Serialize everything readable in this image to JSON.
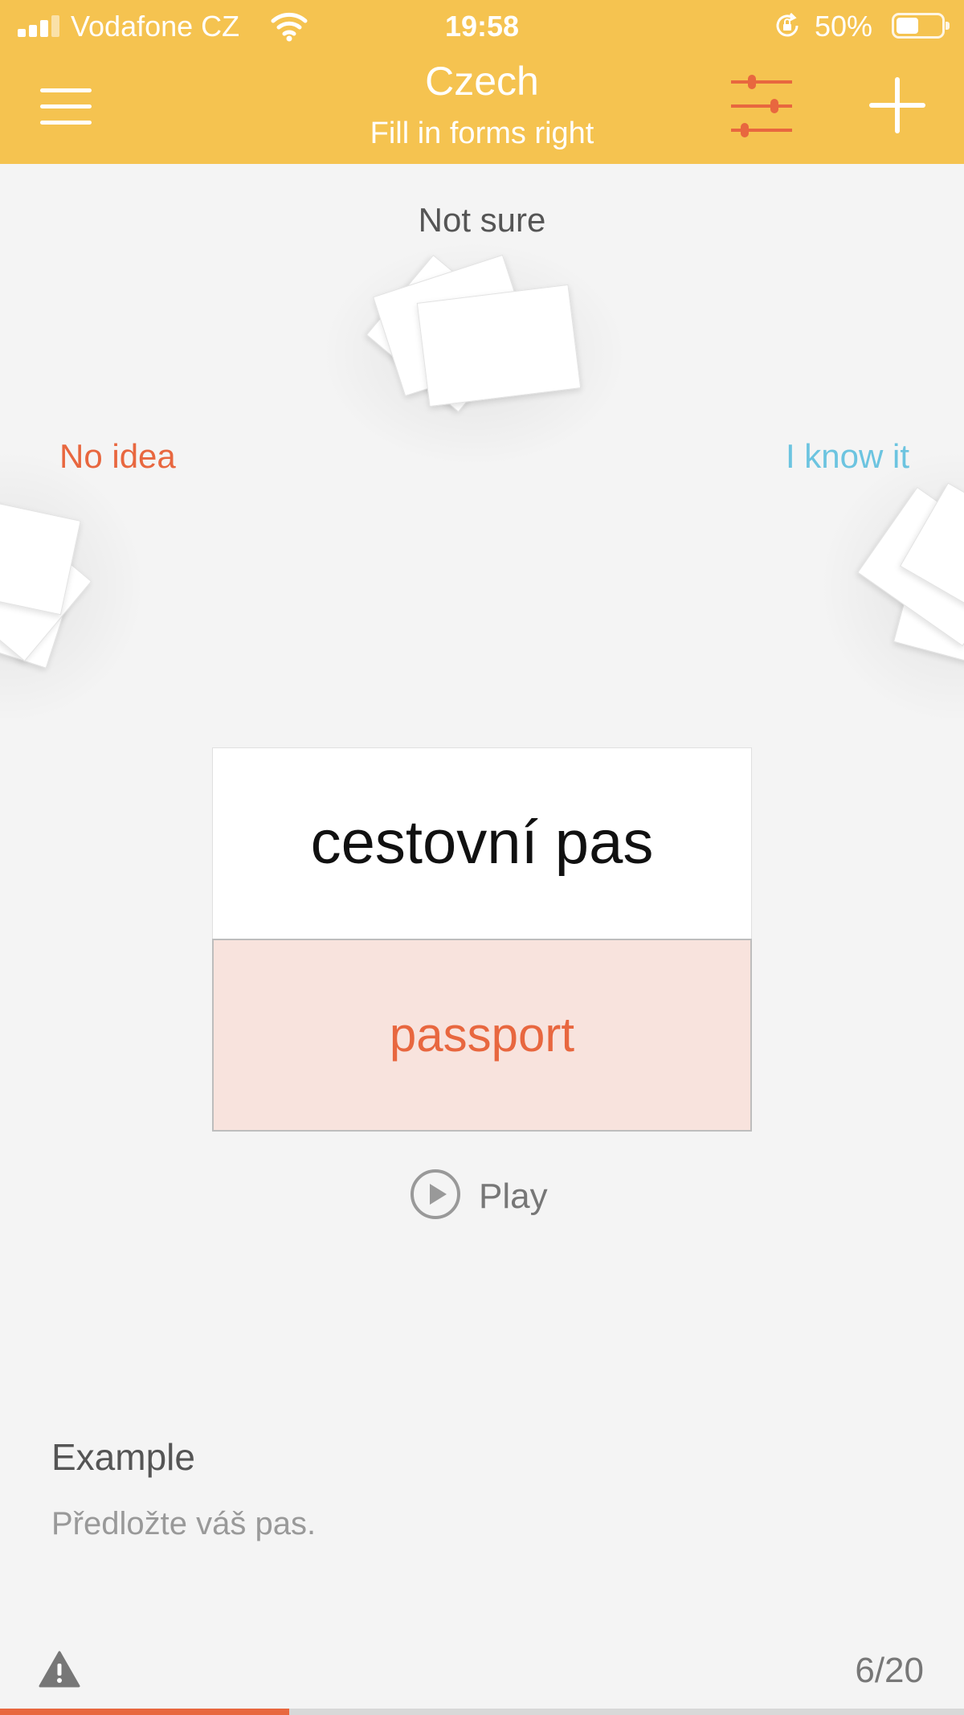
{
  "status_bar": {
    "carrier": "Vodafone CZ",
    "time": "19:58",
    "battery": "50%"
  },
  "header": {
    "title": "Czech",
    "subtitle": "Fill in forms right",
    "menu_icon": "hamburger-menu-icon",
    "filter_icon": "sliders-icon",
    "add_icon": "plus-icon"
  },
  "piles": {
    "not_sure": "Not sure",
    "no_idea": "No idea",
    "know_it": "I know it"
  },
  "card": {
    "front": "cestovní pas",
    "back": "passport"
  },
  "audio": {
    "play_label": "Play",
    "icon": "play-circle-icon"
  },
  "example": {
    "title": "Example",
    "sentence": "Předložte váš pas."
  },
  "footer": {
    "warning_icon": "warning-icon",
    "counter": "6/20",
    "progress_fraction": 0.3
  },
  "colors": {
    "header": "#f5c350",
    "accent_red": "#e8673f",
    "accent_blue": "#6cc4e0",
    "answer_bg": "#f8e3dd"
  }
}
